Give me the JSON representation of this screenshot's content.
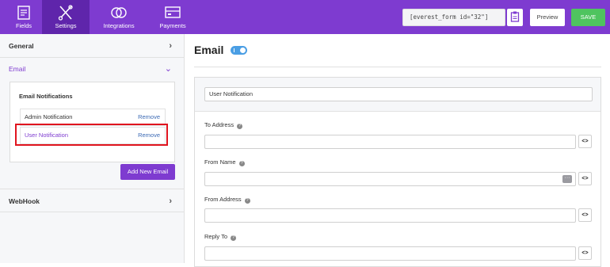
{
  "topnav": {
    "items": [
      {
        "label": "Fields",
        "icon": "fields-icon"
      },
      {
        "label": "Settings",
        "icon": "settings-icon"
      },
      {
        "label": "Integrations",
        "icon": "integrations-icon"
      },
      {
        "label": "Payments",
        "icon": "payments-icon"
      }
    ],
    "active": "Settings",
    "shortcode": "[everest_form id=\"32\"]",
    "preview_label": "Preview",
    "save_label": "SAVE"
  },
  "sidebar": {
    "general_label": "General",
    "email_label": "Email",
    "notifications_title": "Email Notifications",
    "notifications": [
      {
        "label": "Admin Notification",
        "action": "Remove"
      },
      {
        "label": "User Notification",
        "action": "Remove"
      }
    ],
    "add_button": "Add New Email",
    "webhook_label": "WebHook"
  },
  "main": {
    "title": "Email",
    "enabled": true,
    "notification_name": "User Notification",
    "fields": [
      {
        "label": "To Address",
        "value": ""
      },
      {
        "label": "From Name",
        "value": ""
      },
      {
        "label": "From Address",
        "value": ""
      },
      {
        "label": "Reply To",
        "value": ""
      }
    ],
    "code_button": "<>",
    "help_glyph": "?"
  },
  "colors": {
    "brand": "#7e3bd0",
    "save": "#4fc45f",
    "highlight": "#e0141e",
    "toggle": "#4a9ee4"
  }
}
